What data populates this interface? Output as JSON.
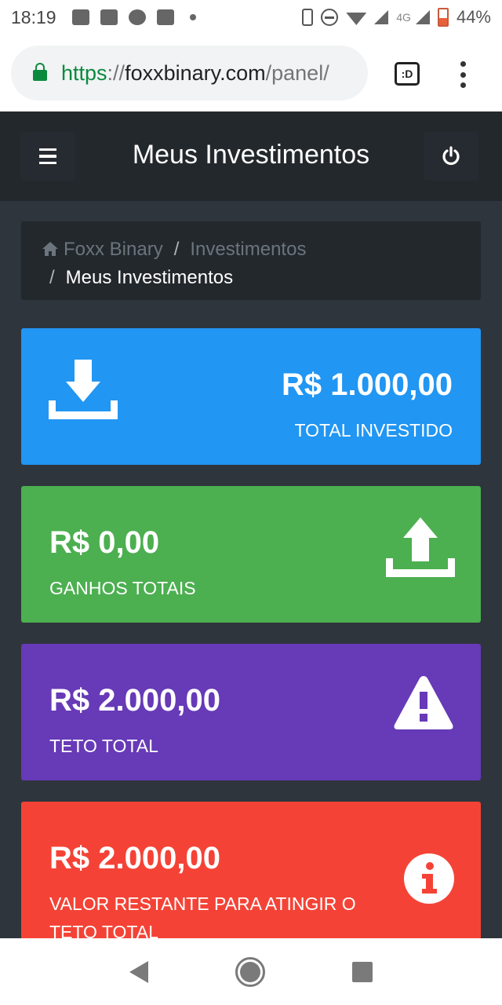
{
  "status_bar": {
    "time": "18:19",
    "network": "4G",
    "battery": "44%"
  },
  "browser": {
    "url_scheme": "https",
    "url_sep": "://",
    "url_host": "foxxbinary.com",
    "url_path": "/panel/",
    "tabs_label": ":D"
  },
  "header": {
    "title": "Meus Investimentos"
  },
  "breadcrumb": {
    "home": "Foxx Binary",
    "sep": "/",
    "section": "Investimentos",
    "current": "Meus Investimentos"
  },
  "cards": [
    {
      "value": "R$ 1.000,00",
      "label": "TOTAL INVESTIDO",
      "color": "#2196f3",
      "icon": "download-icon"
    },
    {
      "value": "R$ 0,00",
      "label": "GANHOS TOTAIS",
      "color": "#4caf50",
      "icon": "upload-icon"
    },
    {
      "value": "R$ 2.000,00",
      "label": "TETO TOTAL",
      "color": "#673ab7",
      "icon": "warning-icon"
    },
    {
      "value": "R$ 2.000,00",
      "label": "VALOR RESTANTE PARA ATINGIR O TETO TOTAL",
      "color": "#f44336",
      "icon": "info-icon"
    }
  ]
}
